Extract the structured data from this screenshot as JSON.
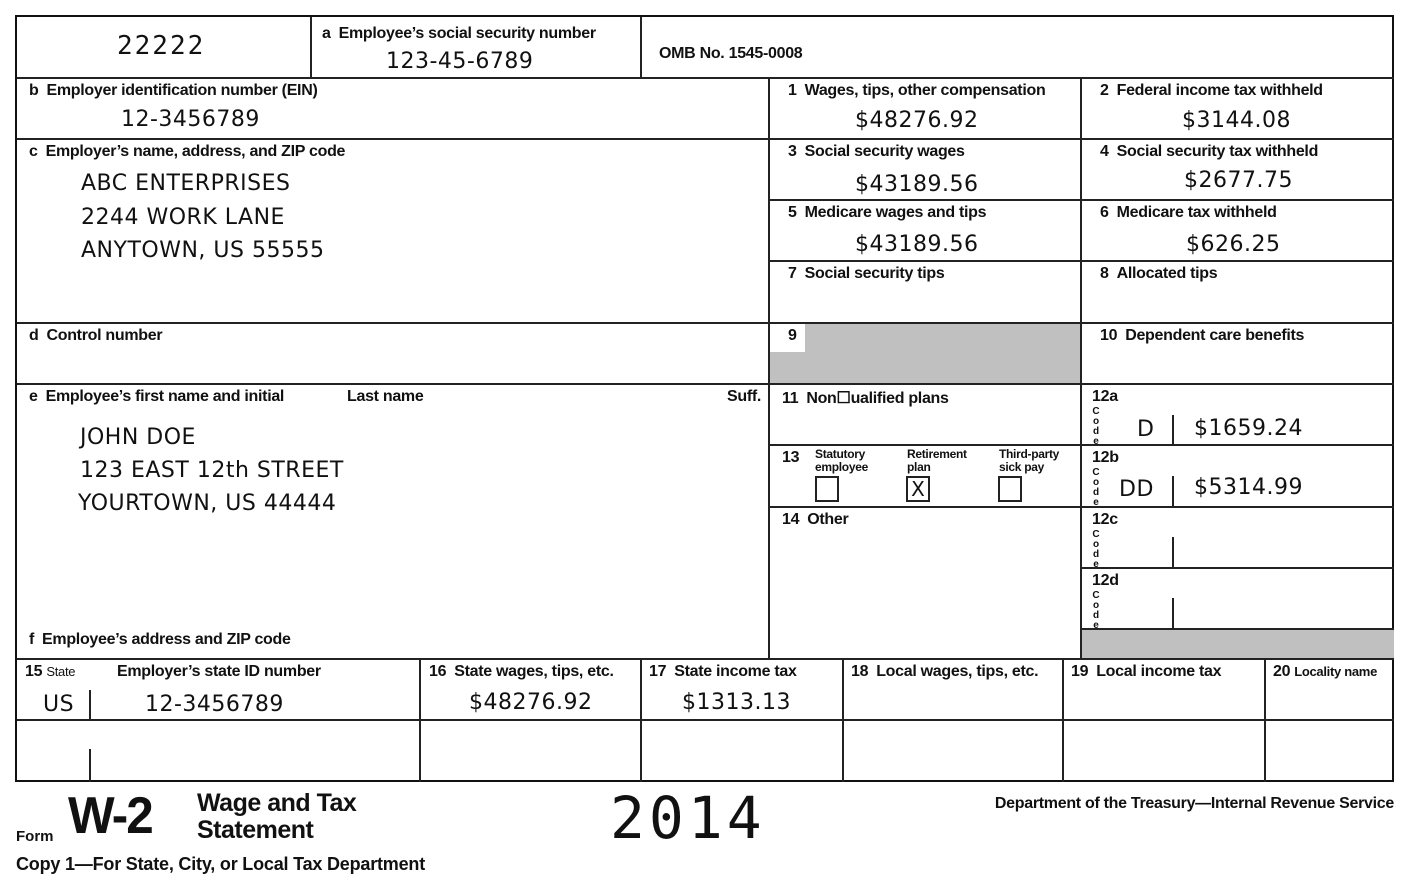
{
  "form": {
    "void_code": "22222",
    "omb": "OMB No. 1545-0008",
    "box_a": {
      "label_letter": "a",
      "label": "Employee’s social security number",
      "value": "123-45-6789"
    },
    "box_b": {
      "label_letter": "b",
      "label": "Employer identification number (EIN)",
      "value": "12-3456789"
    },
    "box_c": {
      "label_letter": "c",
      "label": "Employer’s name, address, and ZIP code",
      "lines": [
        "ABC ENTERPRISES",
        "2244 WORK LANE",
        "ANYTOWN, US  55555"
      ]
    },
    "box_d": {
      "label_letter": "d",
      "label": "Control number",
      "value": ""
    },
    "box_e": {
      "label_letter": "e",
      "label": "Employee’s first name and initial",
      "last_name_label": "Last name",
      "suffix_label": "Suff.",
      "lines": [
        "JOHN DOE",
        "123 EAST 12th STREET",
        "YOURTOWN, US 44444"
      ]
    },
    "box_f": {
      "label_letter": "f",
      "label": "Employee’s address and ZIP code"
    },
    "box_1": {
      "num": "1",
      "label": "Wages, tips, other compensation",
      "value": "$48276.92"
    },
    "box_2": {
      "num": "2",
      "label": "Federal income tax withheld",
      "value": "$3144.08"
    },
    "box_3": {
      "num": "3",
      "label": "Social security wages",
      "value": "$43189.56"
    },
    "box_4": {
      "num": "4",
      "label": "Social security tax withheld",
      "value": "$2677.75"
    },
    "box_5": {
      "num": "5",
      "label": "Medicare wages and tips",
      "value": "$43189.56"
    },
    "box_6": {
      "num": "6",
      "label": "Medicare tax withheld",
      "value": "$626.25"
    },
    "box_7": {
      "num": "7",
      "label": "Social security tips",
      "value": ""
    },
    "box_8": {
      "num": "8",
      "label": "Allocated tips",
      "value": ""
    },
    "box_9": {
      "num": "9"
    },
    "box_10": {
      "num": "10",
      "label": "Dependent care benefits",
      "value": ""
    },
    "box_11": {
      "num": "11",
      "label": "Non☐ualified plans",
      "value": ""
    },
    "box_12a": {
      "num": "12a",
      "code": "D",
      "value": "$1659.24"
    },
    "box_12b": {
      "num": "12b",
      "code": "DD",
      "value": "$5314.99"
    },
    "box_12c": {
      "num": "12c",
      "code": "",
      "value": ""
    },
    "box_12d": {
      "num": "12d",
      "code": "",
      "value": ""
    },
    "code_letters": [
      "C",
      "o",
      "d",
      "e"
    ],
    "box_13": {
      "num": "13",
      "statutory": {
        "label1": "Statutory",
        "label2": "employee",
        "checked": false,
        "mark": ""
      },
      "retirement": {
        "label1": "Retirement",
        "label2": "plan",
        "checked": true,
        "mark": "X"
      },
      "sickpay": {
        "label1": "Third-party",
        "label2": "sick pay",
        "checked": false,
        "mark": ""
      }
    },
    "box_14": {
      "num": "14",
      "label": "Other",
      "value": ""
    },
    "box_15": {
      "num": "15",
      "state_label": "State",
      "id_label": "Employer’s state ID number",
      "rows": [
        {
          "state": "US",
          "id": "12-3456789"
        },
        {
          "state": "",
          "id": ""
        }
      ]
    },
    "box_16": {
      "num": "16",
      "label": "State wages, tips, etc.",
      "rows": [
        "$48276.92",
        ""
      ]
    },
    "box_17": {
      "num": "17",
      "label": "State income tax",
      "rows": [
        "$1313.13",
        ""
      ]
    },
    "box_18": {
      "num": "18",
      "label": "Local wages, tips, etc.",
      "rows": [
        "",
        ""
      ]
    },
    "box_19": {
      "num": "19",
      "label": "Local income tax",
      "rows": [
        "",
        ""
      ]
    },
    "box_20": {
      "num": "20",
      "label": "Locality name",
      "rows": [
        "",
        ""
      ]
    }
  },
  "footer": {
    "form_word": "Form",
    "form_name": "W-2",
    "title_line1": "Wage and Tax",
    "title_line2": "Statement",
    "year": "2014",
    "department": "Department of the Treasury—Internal Revenue Service",
    "copy": "Copy 1—For State, City, or Local Tax Department"
  }
}
